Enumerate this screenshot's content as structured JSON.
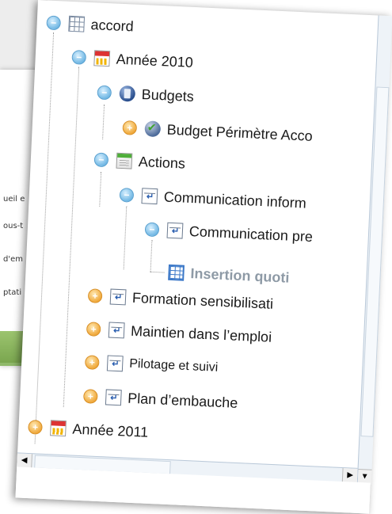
{
  "background_doc": {
    "fragments": [
      "ueil e",
      "ous-t",
      "d'em",
      "ptati"
    ]
  },
  "tree": {
    "root": "accord",
    "year_2010": "Année 2010",
    "budgets": "Budgets",
    "budget_perimetre": "Budget Périmètre Acco",
    "actions": "Actions",
    "communication_inform": "Communication inform",
    "communication_pre": "Communication pre",
    "insertion": "Insertion quoti",
    "formation": "Formation sensibilisati",
    "maintien": "Maintien dans l’emploi",
    "pilotage": "Pilotage et suivi",
    "plan": "Plan d’embauche",
    "year_2011": "Année 2011"
  },
  "icons": {
    "expanded": "minus-circle-icon",
    "collapsed": "plus-circle-icon"
  },
  "colors": {
    "expanded_toggle": "#72b8e4",
    "collapsed_toggle": "#f0a93c",
    "inactive_text": "#8e9aa6"
  }
}
